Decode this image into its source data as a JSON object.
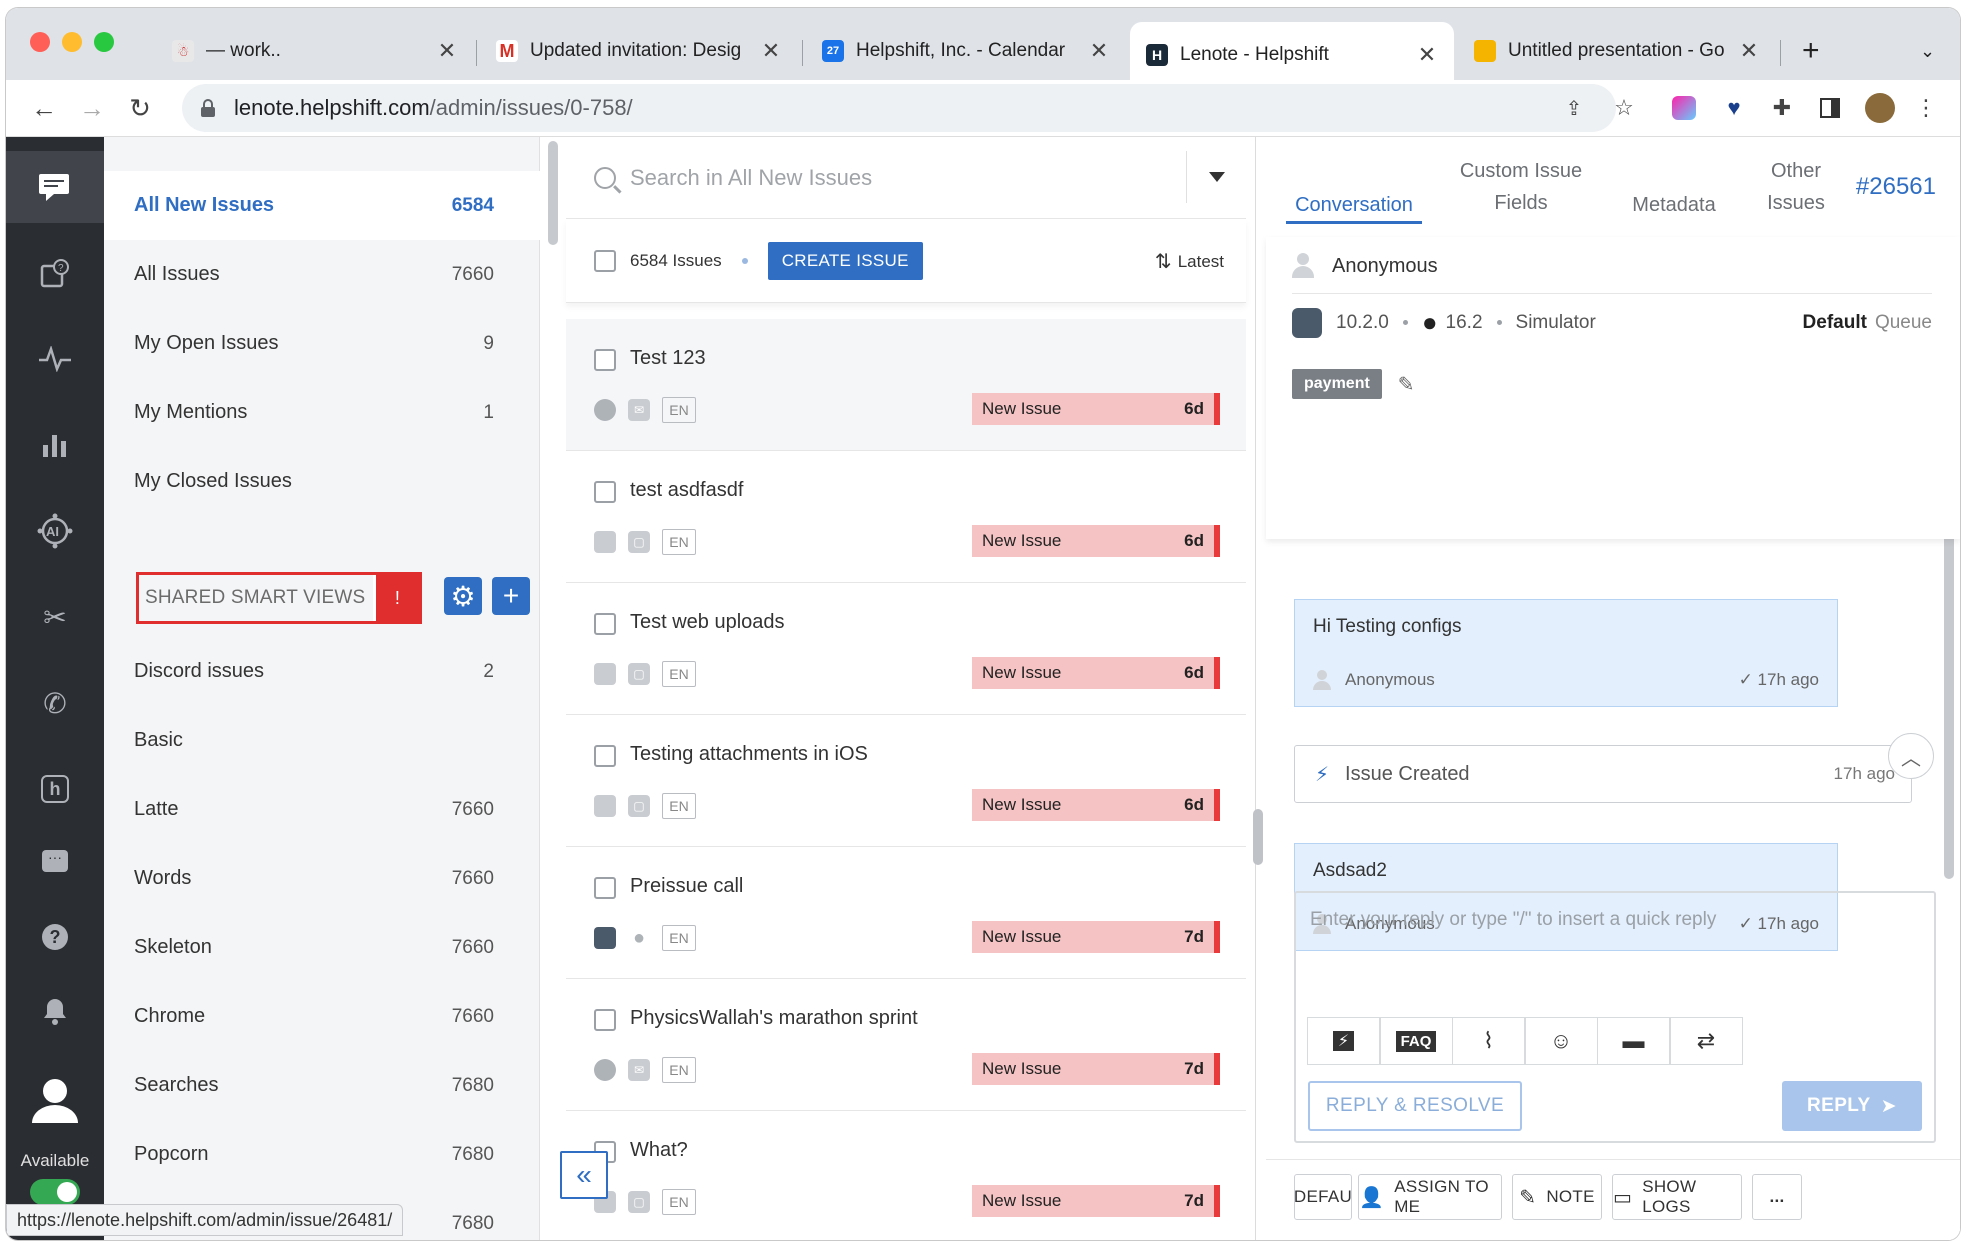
{
  "browser": {
    "tabs": [
      {
        "title": "— work..",
        "favicon": "figure-icon",
        "color": "#e8e8e8"
      },
      {
        "title": "Updated invitation: Desig",
        "favicon": "gmail-icon",
        "color": "#d93025"
      },
      {
        "title": "Helpshift, Inc. - Calendar",
        "favicon": "calendar-icon",
        "color": "#1a73e8"
      },
      {
        "title": "Lenote - Helpshift",
        "favicon": "helpshift-icon",
        "color": "#1b2a38"
      },
      {
        "title": "Untitled presentation - Go",
        "favicon": "slides-icon",
        "color": "#f4b400"
      }
    ],
    "url_host": "lenote.helpshift.com",
    "url_path": "/admin/issues/0-758/",
    "status_url": "https://lenote.helpshift.com/admin/issue/26481/"
  },
  "sidebar": {
    "availability_label": "Available",
    "icons": [
      "chat-icon",
      "faq-icon",
      "analytics-icon",
      "bar-chart-icon",
      "ai-icon",
      "tools-icon",
      "phone-icon",
      "helpshift-logo-icon",
      "message-icon",
      "help-icon",
      "bell-icon",
      "user-icon"
    ]
  },
  "views": {
    "items": [
      {
        "label": "All New Issues",
        "count": "6584"
      },
      {
        "label": "All Issues",
        "count": "7660"
      },
      {
        "label": "My Open Issues",
        "count": "9"
      },
      {
        "label": "My Mentions",
        "count": "1"
      },
      {
        "label": "My Closed Issues",
        "count": ""
      }
    ],
    "smart_views_header": "SHARED SMART VIEWS",
    "smart_views_alert": "!",
    "smart_views": [
      {
        "label": "Discord issues",
        "count": "2"
      },
      {
        "label": "Basic",
        "count": ""
      },
      {
        "label": "Latte",
        "count": "7660"
      },
      {
        "label": "Words",
        "count": "7660"
      },
      {
        "label": "Skeleton",
        "count": "7660"
      },
      {
        "label": "Chrome",
        "count": "7660"
      },
      {
        "label": "Searches",
        "count": "7680"
      },
      {
        "label": "Popcorn",
        "count": "7680"
      },
      {
        "label": "",
        "count": "7680"
      }
    ]
  },
  "issues": {
    "search_placeholder": "Search in All New Issues",
    "count_label": "6584 Issues",
    "create_button": "CREATE ISSUE",
    "sort_label": "Latest",
    "rows": [
      {
        "title": "Test 123",
        "status": "New Issue",
        "age": "6d",
        "lang": "EN"
      },
      {
        "title": "test asdfasdf",
        "status": "New Issue",
        "age": "6d",
        "lang": "EN"
      },
      {
        "title": "Test web uploads",
        "status": "New Issue",
        "age": "6d",
        "lang": "EN"
      },
      {
        "title": "Testing attachments in iOS",
        "status": "New Issue",
        "age": "6d",
        "lang": "EN"
      },
      {
        "title": "Preissue call",
        "status": "New Issue",
        "age": "7d",
        "lang": "EN"
      },
      {
        "title": "PhysicsWallah's marathon sprint",
        "status": "New Issue",
        "age": "7d",
        "lang": "EN"
      },
      {
        "title": "What?",
        "status": "New Issue",
        "age": "7d",
        "lang": "EN"
      }
    ]
  },
  "detail": {
    "tabs": [
      {
        "label": "Conversation"
      },
      {
        "label": "Custom Issue Fields"
      },
      {
        "label": "Metadata"
      },
      {
        "label": "Other Issues"
      }
    ],
    "issue_id": "#26561",
    "user": "Anonymous",
    "app_version": "10.2.0",
    "os_version": "16.2",
    "device": "Simulator",
    "queue_name": "Default",
    "queue_label": "Queue",
    "tag": "payment",
    "messages": [
      {
        "text": "Hi Testing configs",
        "author": "Anonymous",
        "time": "17h ago"
      },
      {
        "event": "Issue Created",
        "time": "17h ago"
      },
      {
        "text": "Asdsad2",
        "author": "Anonymous",
        "time": "17h ago"
      }
    ],
    "reply_placeholder": "Enter your reply or type \"/\" to insert a quick reply",
    "faq_label": "FAQ",
    "reply_resolve": "REPLY & RESOLVE",
    "reply": "REPLY",
    "footer": {
      "default": "DEFAU",
      "assign": "ASSIGN TO ME",
      "note": "NOTE",
      "logs": "SHOW LOGS",
      "more": "..."
    }
  },
  "colors": {
    "accent": "#2f6ec2",
    "status_new": "#f5c3c3",
    "status_bar": "#e83a3a",
    "alert": "#e02d2d"
  }
}
